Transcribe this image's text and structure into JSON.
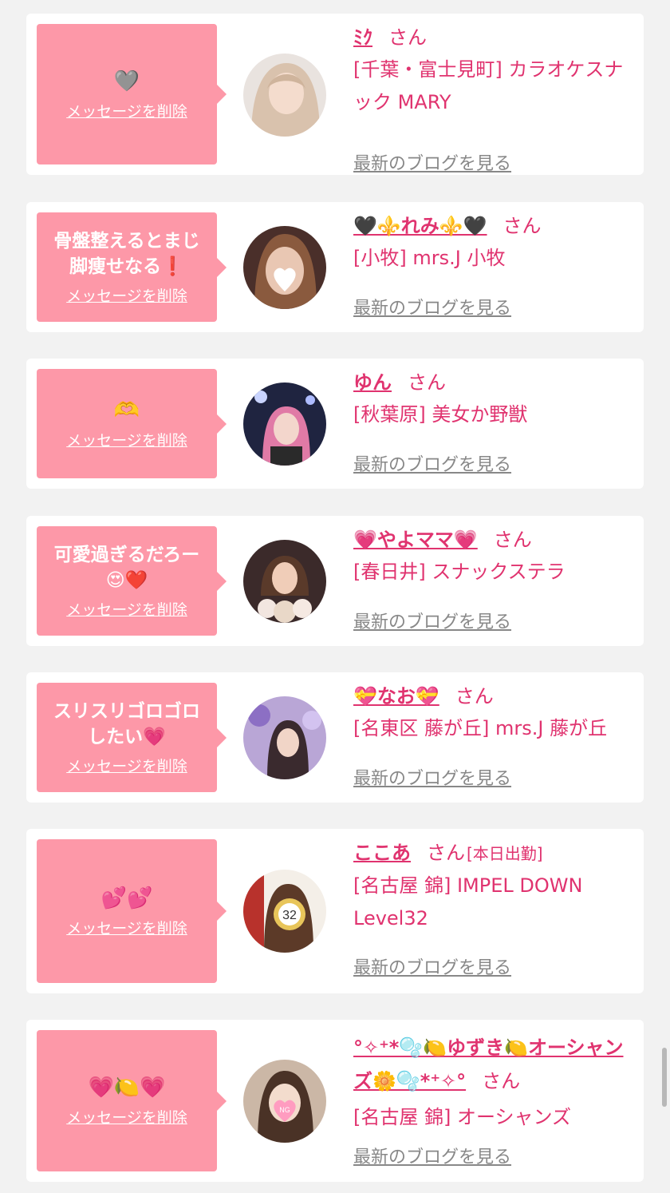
{
  "delete_label": "メッセージを削除",
  "blog_label": "最新のブログを見る",
  "san_label": "さん",
  "colors": {
    "bubble": "#fd98a8",
    "accent": "#e0336f",
    "link_gray": "#888888",
    "background": "#f2f2f2"
  },
  "cards": [
    {
      "message": "🩶",
      "name": "ﾐｸ",
      "work_status": "",
      "shop": "[千葉・富士見町] カラオケスナック MARY",
      "avatar": "avatar-photo-blonde-woman"
    },
    {
      "message": "骨盤整えるとまじ脚痩せなる❗️",
      "name": "🖤⚜️れみ⚜️🖤",
      "work_status": "",
      "shop": "[小牧] mrs.J 小牧",
      "avatar": "avatar-photo-woman-heart-sticker"
    },
    {
      "message": "🫶",
      "name": "ゆん",
      "work_status": "",
      "shop": "[秋葉原] 美女か野獣",
      "avatar": "avatar-photo-pink-hair-woman"
    },
    {
      "message": "可愛過ぎるだろー😍❤️",
      "name": "💗やよママ💗",
      "work_status": "",
      "shop": "[春日井] スナックステラ",
      "avatar": "avatar-photo-woman-flowers"
    },
    {
      "message": "スリスリゴロゴロしたい💗",
      "name": "💝なお💝",
      "work_status": "",
      "shop": "[名東区 藤が丘] mrs.J 藤が丘",
      "avatar": "avatar-photo-woman-purple-flowers"
    },
    {
      "message": "💕💕",
      "name": "ここあ",
      "work_status": "[本日出勤]",
      "shop": "[名古屋 錦] IMPEL DOWN Level32",
      "avatar": "avatar-photo-woman-badge-32"
    },
    {
      "message": "💗🍋💗",
      "name": "°✧⁺*🫧🍋ゆずき🍋オーシャンズ🌼🫧*⁺✧°",
      "work_status": "",
      "shop": "[名古屋 錦] オーシャンズ",
      "avatar": "avatar-photo-woman-ng-sticker"
    }
  ]
}
